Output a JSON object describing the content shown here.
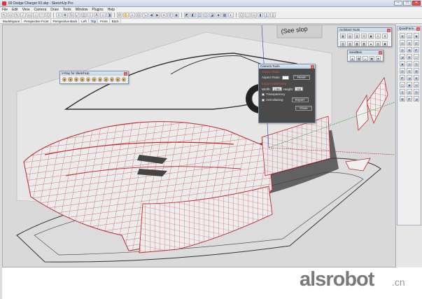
{
  "window": {
    "title": "69 Dodge Charger 03.skp - SketchUp Pro",
    "buttons": [
      "–",
      "□",
      "✕"
    ]
  },
  "menubar": [
    "File",
    "Edit",
    "View",
    "Camera",
    "Draw",
    "Tools",
    "Window",
    "Plugins",
    "Help"
  ],
  "scenes": [
    {
      "label": "Modelspace",
      "active": false
    },
    {
      "label": "Perspective Front",
      "active": false
    },
    {
      "label": "Perspective Back",
      "active": false
    },
    {
      "label": "Left",
      "active": false
    },
    {
      "label": "Top",
      "active": true
    },
    {
      "label": "Front",
      "active": false
    },
    {
      "label": "Back",
      "active": false
    }
  ],
  "toolbar_icons": [
    "select-icon",
    "eraser-icon",
    "pencil-icon",
    "line-icon",
    "rectangle-icon",
    "circle-icon",
    "arc-icon",
    "polygon-icon",
    "push-pull-icon",
    "move-icon",
    "rotate-icon",
    "scale-icon",
    "offset-icon",
    "tape-icon",
    "text-icon",
    "axes-icon",
    "paint-icon",
    "orbit-icon",
    "pan-icon",
    "zoom-icon",
    "zoom-window-icon",
    "zoom-extents-icon",
    "previous-view-icon",
    "next-view-icon",
    "position-camera-icon",
    "walk-icon",
    "look-around-icon",
    "section-plane-icon",
    "xray-icon",
    "back-edges-icon",
    "wireframe-icon",
    "hidden-line-icon",
    "shaded-icon",
    "textured-icon",
    "monochrome-icon",
    "iso-view-icon",
    "top-view-icon",
    "front-view-icon",
    "right-view-icon",
    "back-view-icon",
    "left-view-icon"
  ],
  "panels": {
    "architect_tools": {
      "title": "Architect Tools"
    },
    "sandbox": {
      "title": "SandBox"
    },
    "vray": {
      "title": "V-Ray for SketchUp"
    },
    "quadface": {
      "title": "QuadFace..."
    }
  },
  "camera_tools": {
    "title": "Camera Tools",
    "aspect_ratio_heading": "Aspect Ratio",
    "aspect_ratio_label": "Aspect Ratio:",
    "aspect_ratio_value": "",
    "reset_label": "Reset",
    "safe_frame_heading": "Export Safeframe",
    "width_label": "Width:",
    "width_value": "1366",
    "height_label": "Height:",
    "height_value": "768",
    "transparency_label": "Transparency",
    "antialias_label": "Anti-aliasing",
    "export_label": "Export",
    "close_label": "Close"
  },
  "viewport": {
    "sign_text": "(See slop",
    "colors": {
      "background": "#d9d9d9",
      "surface": "#e9e9e9",
      "wire": "#c0282c",
      "shadow": "#3a3a3a"
    }
  },
  "watermark": {
    "brand": "alsrobot",
    "suffix": ".cn"
  }
}
